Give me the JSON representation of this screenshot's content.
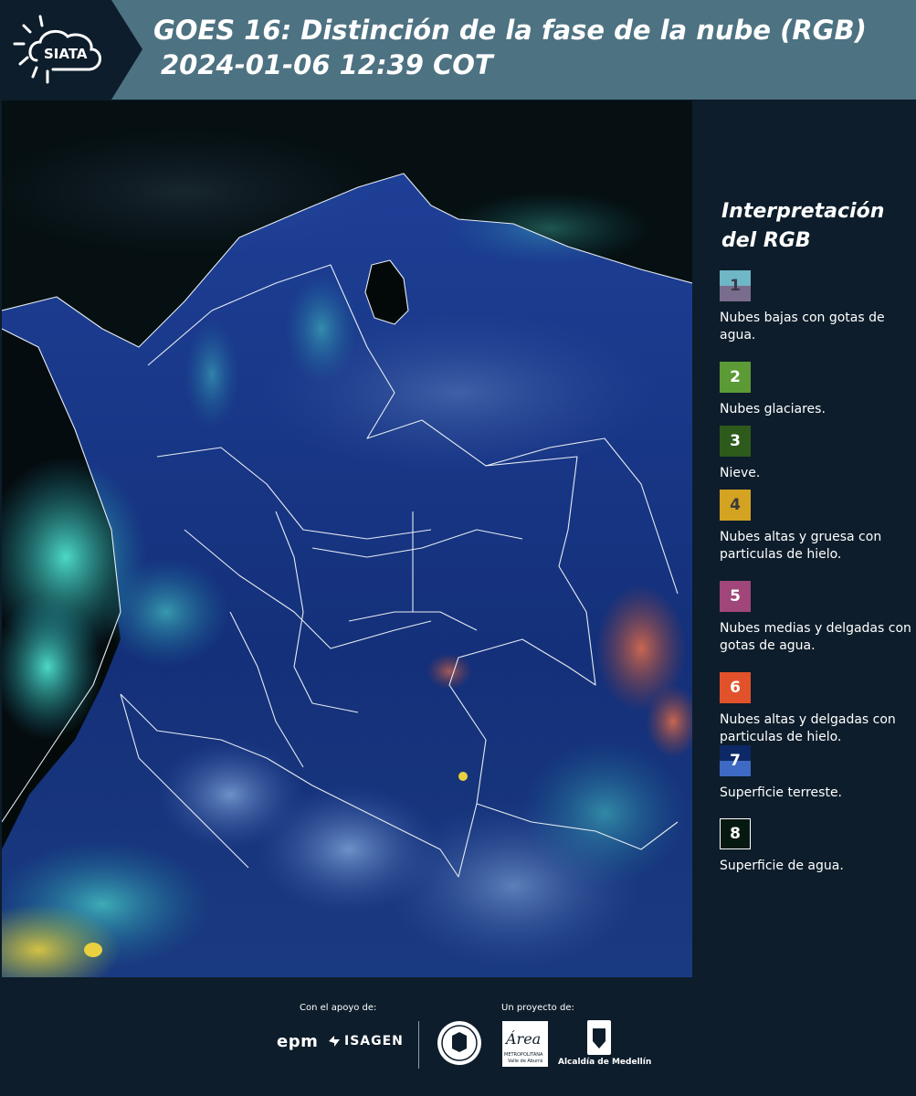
{
  "header": {
    "logo_text": "SIATA",
    "title_line1": "GOES 16: Distinción de la fase de la nube (RGB)",
    "title_line2": "2024-01-06 12:39 COT"
  },
  "legend": {
    "title": "Interpretación del RGB",
    "items": [
      {
        "number": "1",
        "label": "Nubes bajas con gotas de agua.",
        "color_top": "#6fb6c6",
        "color_bottom": "#7a6c8c"
      },
      {
        "number": "2",
        "label": "Nubes glaciares.",
        "color_top": "#5b9a35",
        "color_bottom": "#5b9a35"
      },
      {
        "number": "3",
        "label": "Nieve.",
        "color_top": "#2e5a1c",
        "color_bottom": "#2e5a1c"
      },
      {
        "number": "4",
        "label": "Nubes altas y gruesa con particulas de hielo.",
        "color_top": "#d4a322",
        "color_bottom": "#d4a322"
      },
      {
        "number": "5",
        "label": "Nubes medias y delgadas con gotas de agua.",
        "color_top": "#a0467a",
        "color_bottom": "#a0467a"
      },
      {
        "number": "6",
        "label": "Nubes altas y delgadas con particulas de hielo.",
        "color_top": "#e2522a",
        "color_bottom": "#e2522a"
      },
      {
        "number": "7",
        "label": "Superficie terreste.",
        "color_top": "#0d2866",
        "color_bottom": "#3e6ac4"
      },
      {
        "number": "8",
        "label": "Superficie de agua.",
        "color_top": "#071a12",
        "color_bottom": "#071a12"
      }
    ]
  },
  "footer": {
    "support_label": "Con el apoyo de:",
    "project_label": "Un proyecto de:",
    "sponsor_epm": "epm",
    "sponsor_isagen": "ISAGEN",
    "partner_area": "Área",
    "partner_area_sub": "METROPOLITANA",
    "partner_area_sub2": "Valle de Aburrá",
    "partner_alcaldia": "Alcaldía de Medellín"
  },
  "colors": {
    "header_bg": "#4d7282",
    "panel_bg": "#0d1d2b",
    "map_land": "#1a3a8a",
    "map_water": "#050a08",
    "cloud_cyan": "#40e8d8"
  }
}
